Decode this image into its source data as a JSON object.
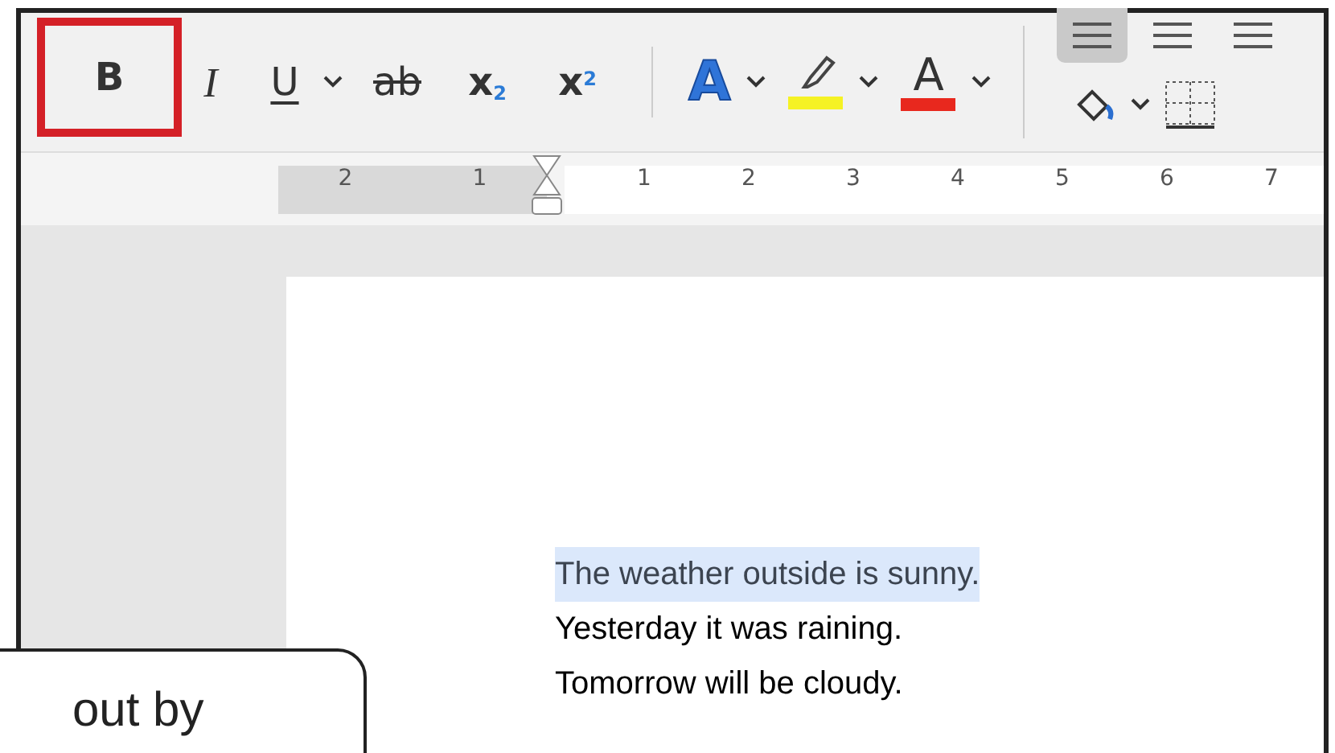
{
  "toolbar": {
    "format_buttons": [
      {
        "kind": "bold",
        "label": "B",
        "highlighted": true
      },
      {
        "kind": "italic",
        "label": "I",
        "highlighted": false
      },
      {
        "kind": "underline",
        "label": "U",
        "highlighted": false,
        "dropdown": true
      },
      {
        "kind": "strike",
        "label": "ab",
        "highlighted": false
      },
      {
        "kind": "subscript",
        "label": "x",
        "script": "2",
        "highlighted": false
      },
      {
        "kind": "superscript",
        "label": "x",
        "script": "2",
        "highlighted": false
      }
    ],
    "color_buttons": [
      {
        "kind": "effects",
        "label": "A"
      },
      {
        "kind": "highlight",
        "color": "#f5f224"
      },
      {
        "kind": "font-color",
        "label": "A",
        "color": "#e8281e"
      }
    ],
    "align_buttons": [
      {
        "selected": true
      },
      {
        "selected": false
      },
      {
        "selected": false
      }
    ]
  },
  "ruler": {
    "left_numbers": [
      "2",
      "1"
    ],
    "right_numbers": [
      "1",
      "2",
      "3",
      "4",
      "5",
      "6",
      "7"
    ]
  },
  "document": {
    "lines": [
      {
        "text": "The weather outside is sunny.",
        "selected": true
      },
      {
        "text": "Yesterday it was raining.",
        "selected": false
      },
      {
        "text": "Tomorrow will be cloudy.",
        "selected": false
      }
    ]
  },
  "callout": {
    "text": "out by"
  }
}
